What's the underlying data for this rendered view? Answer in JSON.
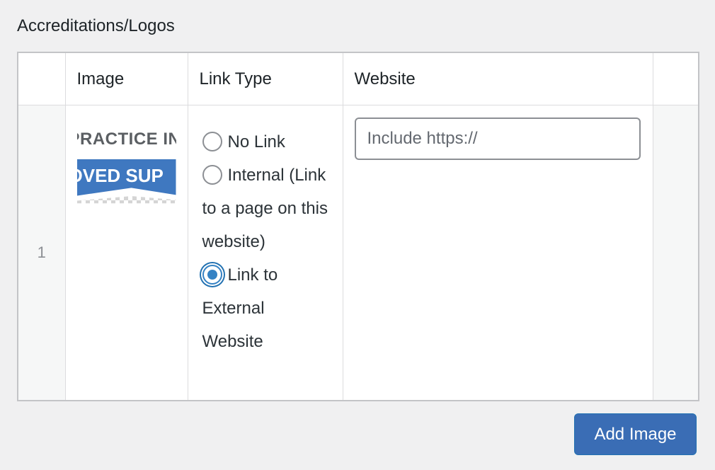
{
  "field": {
    "label": "Accreditations/Logos"
  },
  "table": {
    "headers": {
      "order": "",
      "image": "Image",
      "link_type": "Link Type",
      "website": "Website",
      "actions": ""
    },
    "rows": [
      {
        "order": "1",
        "image": {
          "logo_text_top": "PRACTICE IN",
          "logo_text_band": "OVED SUP",
          "brand_color": "#3f78c0"
        },
        "link_type": {
          "options": [
            {
              "label": "No Link",
              "checked": false
            },
            {
              "label": "Internal (Link to a page on this website)",
              "checked": false
            },
            {
              "label": "Link to External Website",
              "checked": true
            }
          ]
        },
        "website": {
          "value": "",
          "placeholder": "Include https://"
        }
      }
    ]
  },
  "actions": {
    "add_button_label": "Add Image"
  },
  "colors": {
    "background": "#f0f0f1",
    "button": "#3a6db5",
    "radio_checked": "#3582c4"
  }
}
